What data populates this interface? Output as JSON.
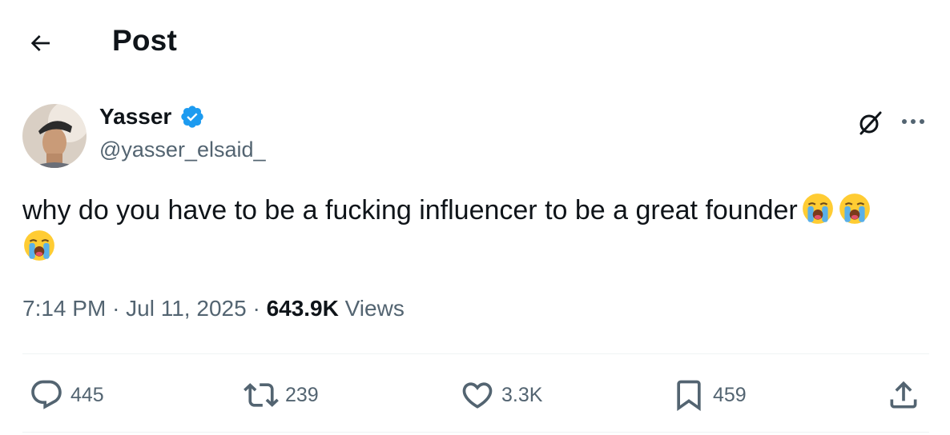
{
  "header": {
    "title": "Post"
  },
  "author": {
    "display_name": "Yasser",
    "handle": "@yasser_elsaid_"
  },
  "tweet": {
    "text": "why do you have to be a fucking influencer to be a great founder"
  },
  "meta": {
    "time": "7:14 PM",
    "sep1": "·",
    "date": "Jul 11, 2025",
    "sep2": "·",
    "views_count": "643.9K",
    "views_label": "Views"
  },
  "actions": {
    "replies": "445",
    "reposts": "239",
    "likes": "3.3K",
    "bookmarks": "459"
  },
  "colors": {
    "text_primary": "#0f1419",
    "text_secondary": "#536471",
    "verified_blue": "#1d9bf0",
    "divider": "#eff3f4"
  },
  "icons": [
    "back-arrow-icon",
    "verified-badge-icon",
    "grok-icon",
    "more-icon",
    "reply-icon",
    "repost-icon",
    "like-icon",
    "bookmark-icon",
    "share-icon",
    "crying-face-emoji"
  ]
}
